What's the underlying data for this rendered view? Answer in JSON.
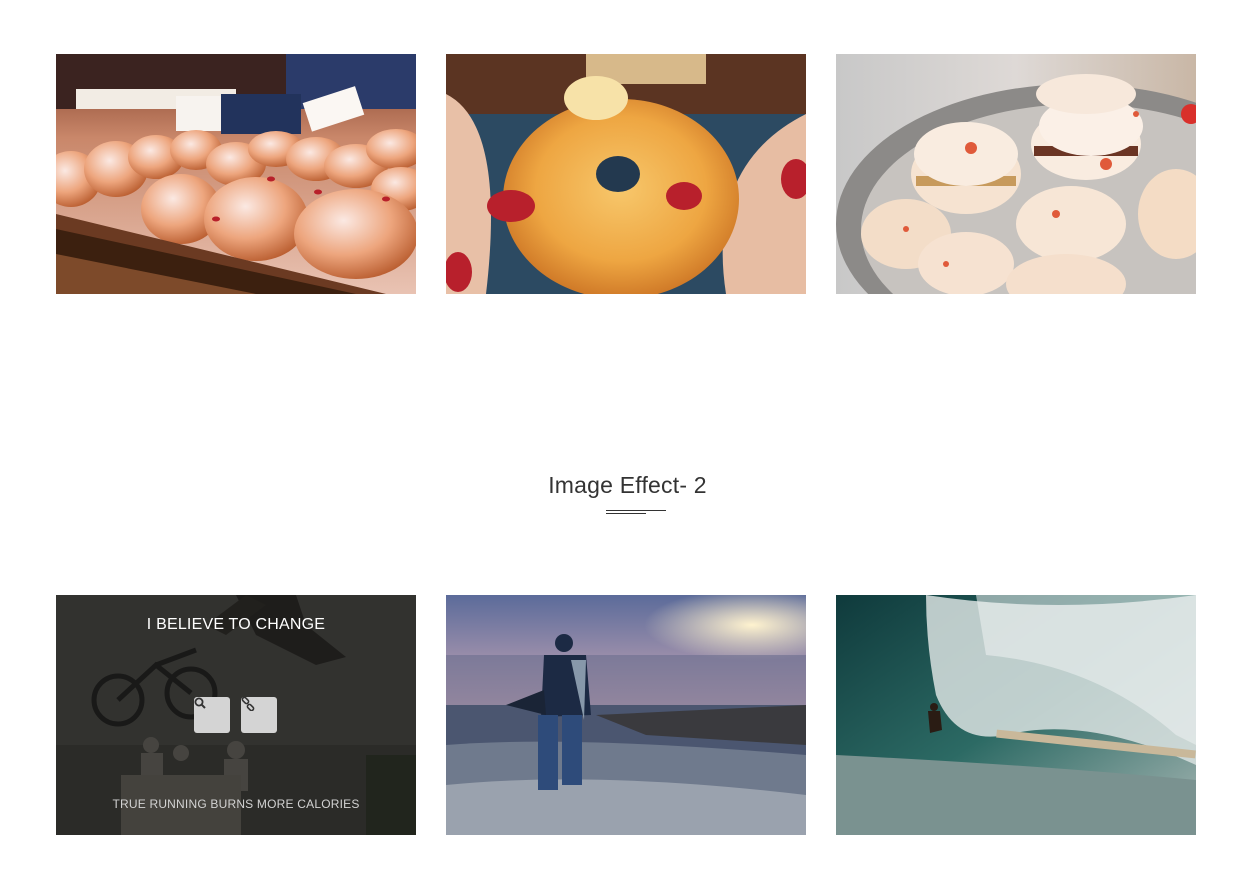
{
  "gallery_top": {
    "images": [
      {
        "name": "jelly-donuts-tray"
      },
      {
        "name": "bitten-sugar-donut"
      },
      {
        "name": "macarons-bowl"
      }
    ]
  },
  "section": {
    "title": "Image Effect- 2"
  },
  "gallery_bottom": {
    "hover_card": {
      "title": "I BELIEVE TO CHANGE",
      "caption": "TRUE RUNNING BURNS MORE CALORIES",
      "search_icon": "search-icon",
      "link_icon": "link-icon"
    },
    "images": [
      {
        "name": "bmx-rider"
      },
      {
        "name": "man-walking-on-rocky-shore"
      },
      {
        "name": "surfer-in-wave-barrel"
      }
    ]
  },
  "colors": {
    "title_text": "#333333",
    "overlay": "#1c1c1a",
    "overlay_button": "#d4d4d4"
  }
}
